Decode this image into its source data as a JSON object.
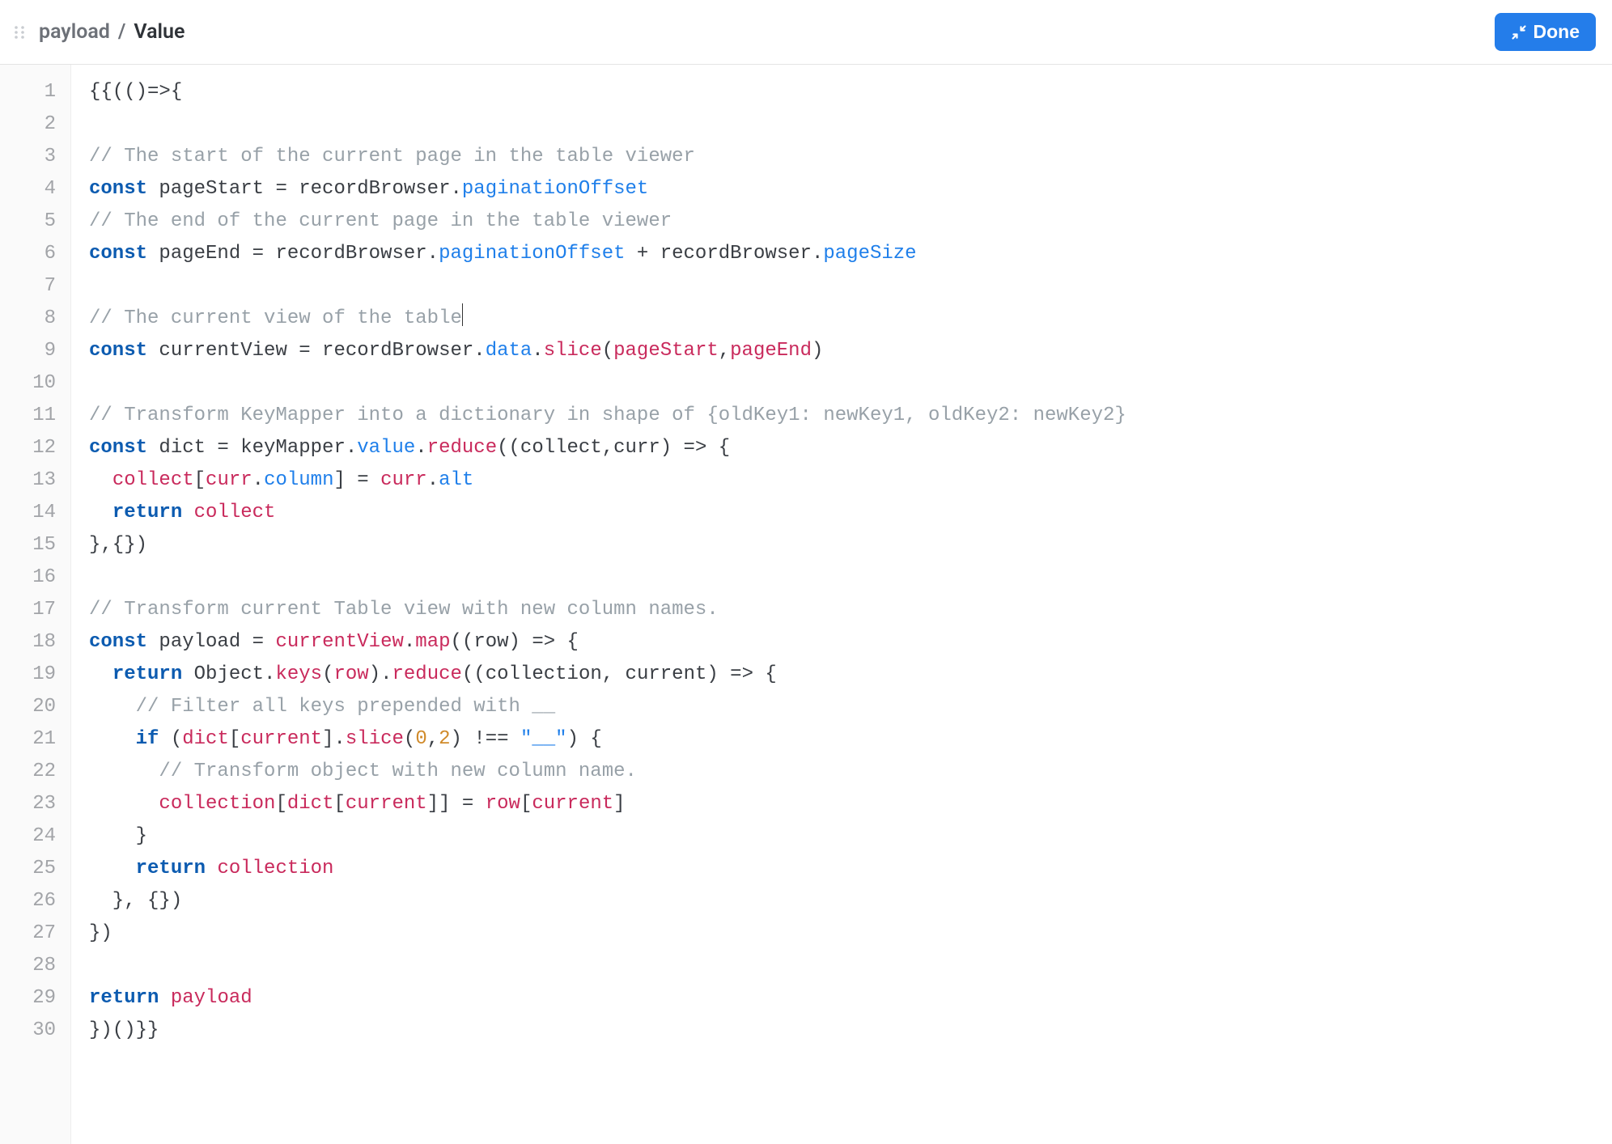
{
  "header": {
    "breadcrumb": {
      "first": "payload",
      "sep": "/",
      "second": "Value"
    },
    "done_label": "Done"
  },
  "editor": {
    "start_line": 1,
    "cursor": {
      "line": 8,
      "col": 33
    },
    "lines": [
      [
        {
          "t": "pl",
          "v": "{{(()=>{"
        }
      ],
      [],
      [
        {
          "t": "cm",
          "v": "// The start of the current page in the table viewer"
        }
      ],
      [
        {
          "t": "kw",
          "v": "const"
        },
        {
          "t": "pl",
          "v": " pageStart = recordBrowser."
        },
        {
          "t": "prop",
          "v": "paginationOffset"
        }
      ],
      [
        {
          "t": "cm",
          "v": "// The end of the current page in the table viewer"
        }
      ],
      [
        {
          "t": "kw",
          "v": "const"
        },
        {
          "t": "pl",
          "v": " pageEnd = recordBrowser."
        },
        {
          "t": "prop",
          "v": "paginationOffset"
        },
        {
          "t": "pl",
          "v": " + recordBrowser."
        },
        {
          "t": "prop",
          "v": "pageSize"
        }
      ],
      [],
      [
        {
          "t": "cm",
          "v": "// The current view of the table"
        }
      ],
      [
        {
          "t": "kw",
          "v": "const"
        },
        {
          "t": "pl",
          "v": " currentView = recordBrowser."
        },
        {
          "t": "prop",
          "v": "data"
        },
        {
          "t": "pl",
          "v": "."
        },
        {
          "t": "fn",
          "v": "slice"
        },
        {
          "t": "pl",
          "v": "("
        },
        {
          "t": "id",
          "v": "pageStart"
        },
        {
          "t": "pl",
          "v": ","
        },
        {
          "t": "id",
          "v": "pageEnd"
        },
        {
          "t": "pl",
          "v": ")"
        }
      ],
      [],
      [
        {
          "t": "cm",
          "v": "// Transform KeyMapper into a dictionary in shape of {oldKey1: newKey1, oldKey2: newKey2}"
        }
      ],
      [
        {
          "t": "kw",
          "v": "const"
        },
        {
          "t": "pl",
          "v": " dict = keyMapper."
        },
        {
          "t": "prop",
          "v": "value"
        },
        {
          "t": "pl",
          "v": "."
        },
        {
          "t": "fn",
          "v": "reduce"
        },
        {
          "t": "pl",
          "v": "((collect,curr) => {"
        }
      ],
      [
        {
          "t": "pl",
          "v": "  "
        },
        {
          "t": "id",
          "v": "collect"
        },
        {
          "t": "pl",
          "v": "["
        },
        {
          "t": "id",
          "v": "curr"
        },
        {
          "t": "pl",
          "v": "."
        },
        {
          "t": "prop",
          "v": "column"
        },
        {
          "t": "pl",
          "v": "] = "
        },
        {
          "t": "id",
          "v": "curr"
        },
        {
          "t": "pl",
          "v": "."
        },
        {
          "t": "prop",
          "v": "alt"
        }
      ],
      [
        {
          "t": "pl",
          "v": "  "
        },
        {
          "t": "kw",
          "v": "return"
        },
        {
          "t": "pl",
          "v": " "
        },
        {
          "t": "id",
          "v": "collect"
        }
      ],
      [
        {
          "t": "pl",
          "v": "},{})"
        }
      ],
      [],
      [
        {
          "t": "cm",
          "v": "// Transform current Table view with new column names."
        }
      ],
      [
        {
          "t": "kw",
          "v": "const"
        },
        {
          "t": "pl",
          "v": " payload = "
        },
        {
          "t": "id",
          "v": "currentView"
        },
        {
          "t": "pl",
          "v": "."
        },
        {
          "t": "fn",
          "v": "map"
        },
        {
          "t": "pl",
          "v": "((row) => {"
        }
      ],
      [
        {
          "t": "pl",
          "v": "  "
        },
        {
          "t": "kw",
          "v": "return"
        },
        {
          "t": "pl",
          "v": " Object."
        },
        {
          "t": "fn",
          "v": "keys"
        },
        {
          "t": "pl",
          "v": "("
        },
        {
          "t": "id",
          "v": "row"
        },
        {
          "t": "pl",
          "v": ")."
        },
        {
          "t": "fn",
          "v": "reduce"
        },
        {
          "t": "pl",
          "v": "((collection, current) => {"
        }
      ],
      [
        {
          "t": "pl",
          "v": "    "
        },
        {
          "t": "cm",
          "v": "// Filter all keys prepended with __"
        }
      ],
      [
        {
          "t": "pl",
          "v": "    "
        },
        {
          "t": "kw",
          "v": "if"
        },
        {
          "t": "pl",
          "v": " ("
        },
        {
          "t": "id",
          "v": "dict"
        },
        {
          "t": "pl",
          "v": "["
        },
        {
          "t": "id",
          "v": "current"
        },
        {
          "t": "pl",
          "v": "]."
        },
        {
          "t": "fn",
          "v": "slice"
        },
        {
          "t": "pl",
          "v": "("
        },
        {
          "t": "num",
          "v": "0"
        },
        {
          "t": "pl",
          "v": ","
        },
        {
          "t": "num",
          "v": "2"
        },
        {
          "t": "pl",
          "v": ") !== "
        },
        {
          "t": "str",
          "v": "\"__\""
        },
        {
          "t": "pl",
          "v": ") {"
        }
      ],
      [
        {
          "t": "pl",
          "v": "      "
        },
        {
          "t": "cm",
          "v": "// Transform object with new column name."
        }
      ],
      [
        {
          "t": "pl",
          "v": "      "
        },
        {
          "t": "id",
          "v": "collection"
        },
        {
          "t": "pl",
          "v": "["
        },
        {
          "t": "id",
          "v": "dict"
        },
        {
          "t": "pl",
          "v": "["
        },
        {
          "t": "id",
          "v": "current"
        },
        {
          "t": "pl",
          "v": "]] = "
        },
        {
          "t": "id",
          "v": "row"
        },
        {
          "t": "pl",
          "v": "["
        },
        {
          "t": "id",
          "v": "current"
        },
        {
          "t": "pl",
          "v": "]"
        }
      ],
      [
        {
          "t": "pl",
          "v": "    }"
        }
      ],
      [
        {
          "t": "pl",
          "v": "    "
        },
        {
          "t": "kw",
          "v": "return"
        },
        {
          "t": "pl",
          "v": " "
        },
        {
          "t": "id",
          "v": "collection"
        }
      ],
      [
        {
          "t": "pl",
          "v": "  }, {})"
        }
      ],
      [
        {
          "t": "pl",
          "v": "})"
        }
      ],
      [],
      [
        {
          "t": "kw",
          "v": "return"
        },
        {
          "t": "pl",
          "v": " "
        },
        {
          "t": "id",
          "v": "payload"
        }
      ],
      [
        {
          "t": "pl",
          "v": "})()}}"
        }
      ]
    ]
  }
}
